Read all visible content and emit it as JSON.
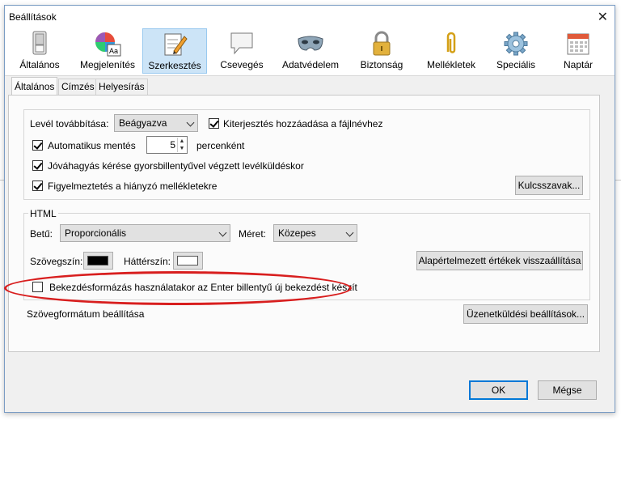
{
  "window": {
    "title": "Beállítások",
    "close_glyph": "✕"
  },
  "toolbar": {
    "items": [
      {
        "label": "Általános",
        "icon": "switch-icon"
      },
      {
        "label": "Megjelenítés",
        "icon": "color-palette-icon"
      },
      {
        "label": "Szerkesztés",
        "icon": "edit-notepad-icon",
        "selected": true
      },
      {
        "label": "Csevegés",
        "icon": "chat-bubble-icon"
      },
      {
        "label": "Adatvédelem",
        "icon": "mask-icon"
      },
      {
        "label": "Biztonság",
        "icon": "padlock-icon"
      },
      {
        "label": "Mellékletek",
        "icon": "paperclip-icon"
      },
      {
        "label": "Speciális",
        "icon": "gear-icon"
      },
      {
        "label": "Naptár",
        "icon": "calendar-icon"
      }
    ]
  },
  "tabs": [
    {
      "label": "Általános",
      "selected": true
    },
    {
      "label": "Címzés"
    },
    {
      "label": "Helyesírás"
    }
  ],
  "general": {
    "forward_label": "Levél továbbítása:",
    "forward_value": "Beágyazva",
    "add_extension_label": "Kiterjesztés hozzáadása a fájlnévhez",
    "add_extension_checked": true,
    "autosave_label": "Automatikus mentés",
    "autosave_checked": true,
    "autosave_minutes": "5",
    "autosave_unit": "percenként",
    "confirm_shortcut_label": "Jóváhagyás kérése gyorsbillentyűvel végzett levélküldéskor",
    "confirm_shortcut_checked": true,
    "missing_attachment_label": "Figyelmeztetés a hiányzó mellékletekre",
    "missing_attachment_checked": true,
    "keywords_button": "Kulcsszavak..."
  },
  "html": {
    "group_label": "HTML",
    "font_label": "Betű:",
    "font_value": "Proporcionális",
    "size_label": "Méret:",
    "size_value": "Közepes",
    "text_color_label": "Szövegszín:",
    "text_color": "#000000",
    "bg_color_label": "Háttérszín:",
    "bg_color": "#ffffff",
    "restore_defaults_button": "Alapértelmezett értékek visszaállítása",
    "paragraph_format_label": "Bekezdésformázás használatakor az Enter billentyű új bekezdést készít",
    "paragraph_format_checked": false
  },
  "format": {
    "label": "Szövegformátum beállítása",
    "sending_options_button": "Üzenetküldési beállítások..."
  },
  "buttons": {
    "ok": "OK",
    "cancel": "Mégse"
  },
  "colors": {
    "accent": "#0078d7",
    "selected_bg": "#cce4f7",
    "highlight_ellipse": "#d81e1e"
  }
}
